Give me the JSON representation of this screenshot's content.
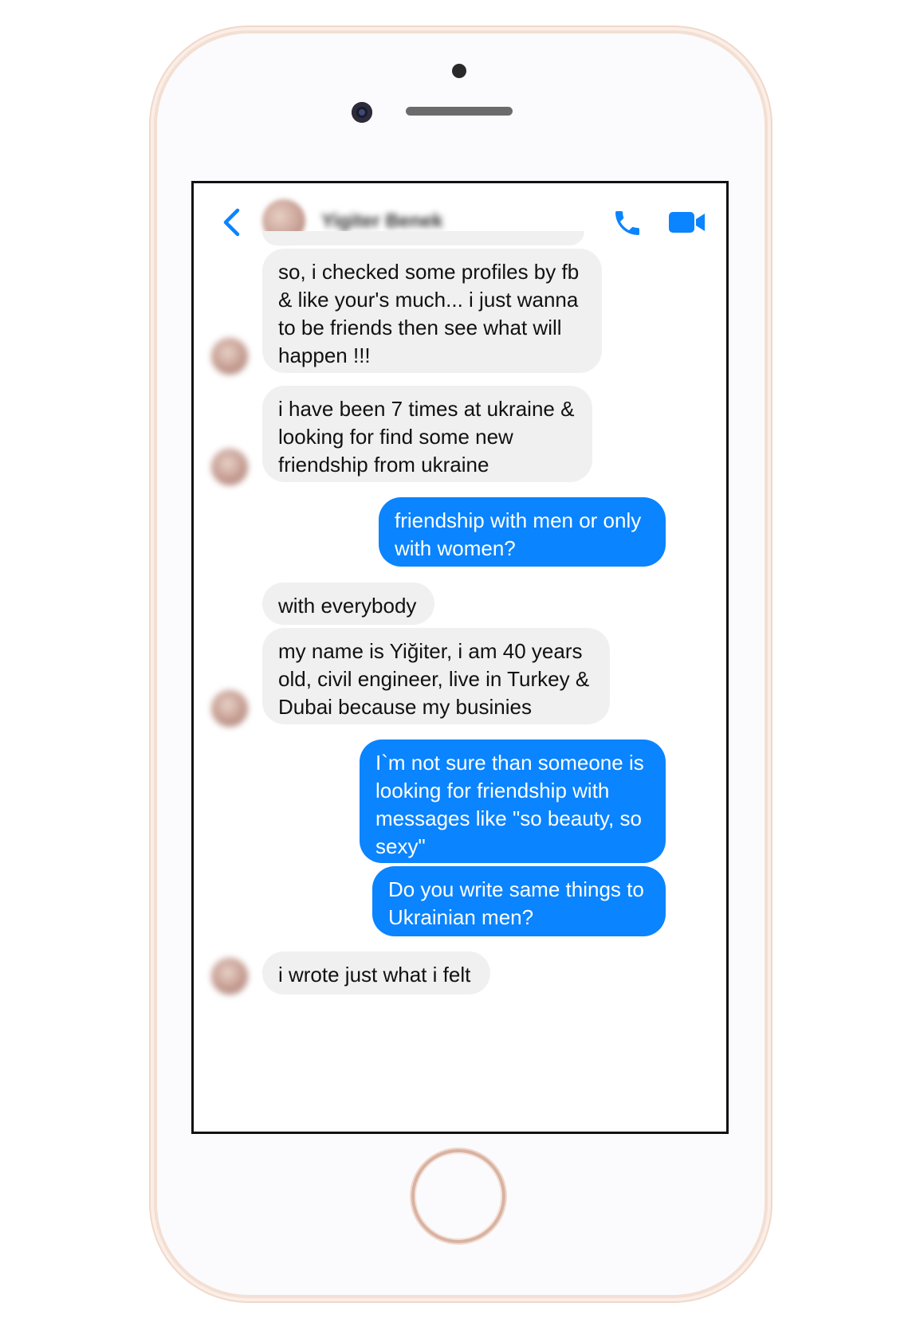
{
  "header": {
    "contact_name": "Yigiter Benek",
    "back_icon": "chevron-left-icon",
    "call_icon": "phone-icon",
    "video_icon": "video-camera-icon",
    "accent_color": "#0a84ff"
  },
  "messages": [
    {
      "side": "incoming",
      "text": "so, i checked some profiles by fb & like your's much... i just wanna to be friends then see what will happen !!!"
    },
    {
      "side": "incoming",
      "text": "i have been 7 times at ukraine & looking for find some new friendship from ukraine"
    },
    {
      "side": "outgoing",
      "text": "friendship with men or only with women?"
    },
    {
      "side": "incoming",
      "text": "with everybody"
    },
    {
      "side": "incoming",
      "text": "my name is Yiğiter, i am 40 years old, civil engineer, live in Turkey & Dubai because my businies"
    },
    {
      "side": "outgoing",
      "text": "I`m not sure than someone is looking for friendship with messages like \"so beauty, so sexy\""
    },
    {
      "side": "outgoing",
      "text": "Do you write same things to Ukrainian men?"
    },
    {
      "side": "incoming",
      "text": "i wrote just what i felt"
    }
  ],
  "colors": {
    "incoming_bubble": "#f0f0f0",
    "outgoing_bubble": "#0a84ff",
    "phone_frame": "#f3dfd3"
  }
}
